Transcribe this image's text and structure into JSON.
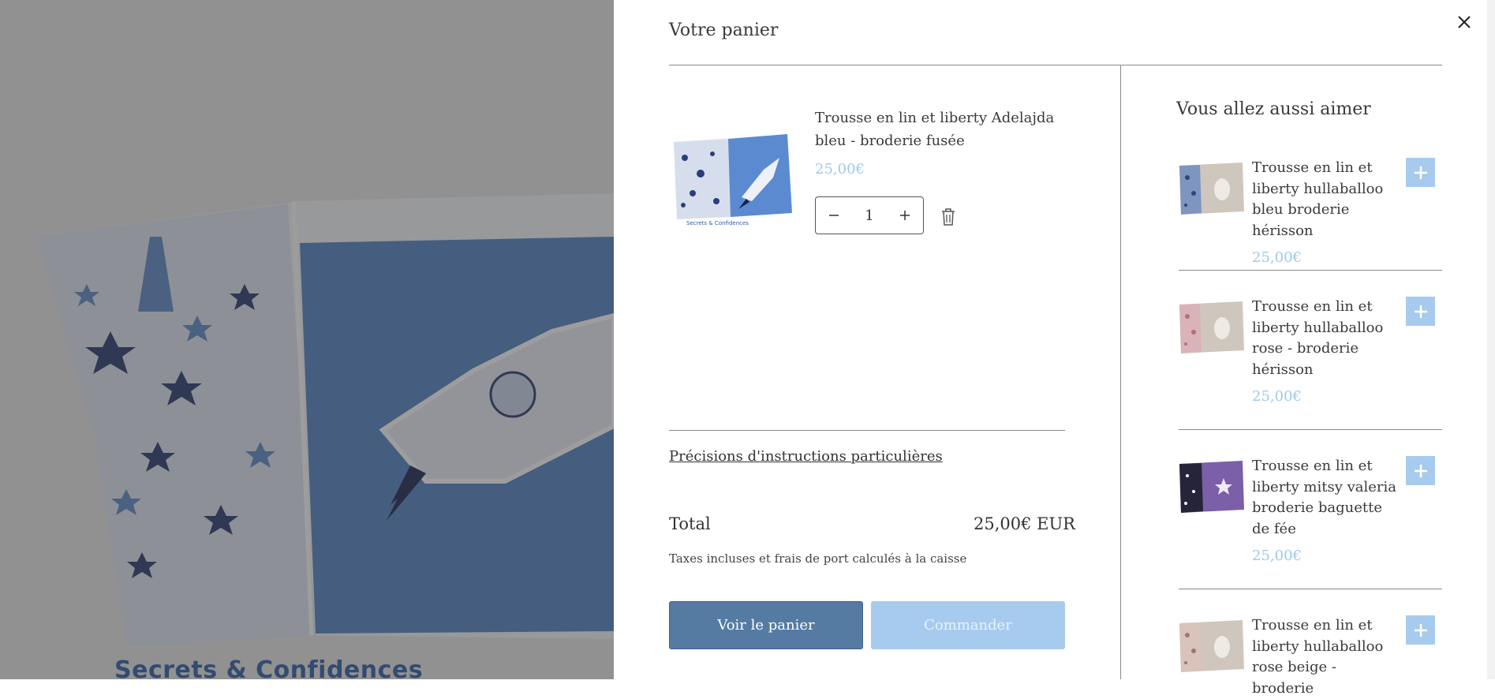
{
  "background": {
    "brand_text": "Secrets & Confidences"
  },
  "cart": {
    "title": "Votre panier",
    "close_icon": "close-icon",
    "item": {
      "title": "Trousse en lin et liberty Adelajda bleu - broderie fusée",
      "price": "25,00€",
      "quantity": "1"
    },
    "notes_link": "Précisions d'instructions particulières",
    "total_label": "Total",
    "total_value": "25,00€ EUR",
    "tax_note": "Taxes incluses et frais de port calculés à la caisse",
    "view_cart_label": "Voir le panier",
    "checkout_label": "Commander",
    "colors": {
      "accent_light": "#a7cbef",
      "accent_dark": "#557ba3",
      "price": "#9fc8ee"
    }
  },
  "recommendations": {
    "title": "Vous allez aussi aimer",
    "items": [
      {
        "name": "Trousse en lin et liberty hullaballoo bleu broderie hérisson",
        "price": "25,00€"
      },
      {
        "name": "Trousse en lin et liberty hullaballoo rose - broderie hérisson",
        "price": "25,00€"
      },
      {
        "name": "Trousse en lin et liberty mitsy valeria broderie baguette de fée",
        "price": "25,00€"
      },
      {
        "name": "Trousse en lin et liberty hullaballoo rose beige - broderie",
        "price": ""
      }
    ]
  }
}
